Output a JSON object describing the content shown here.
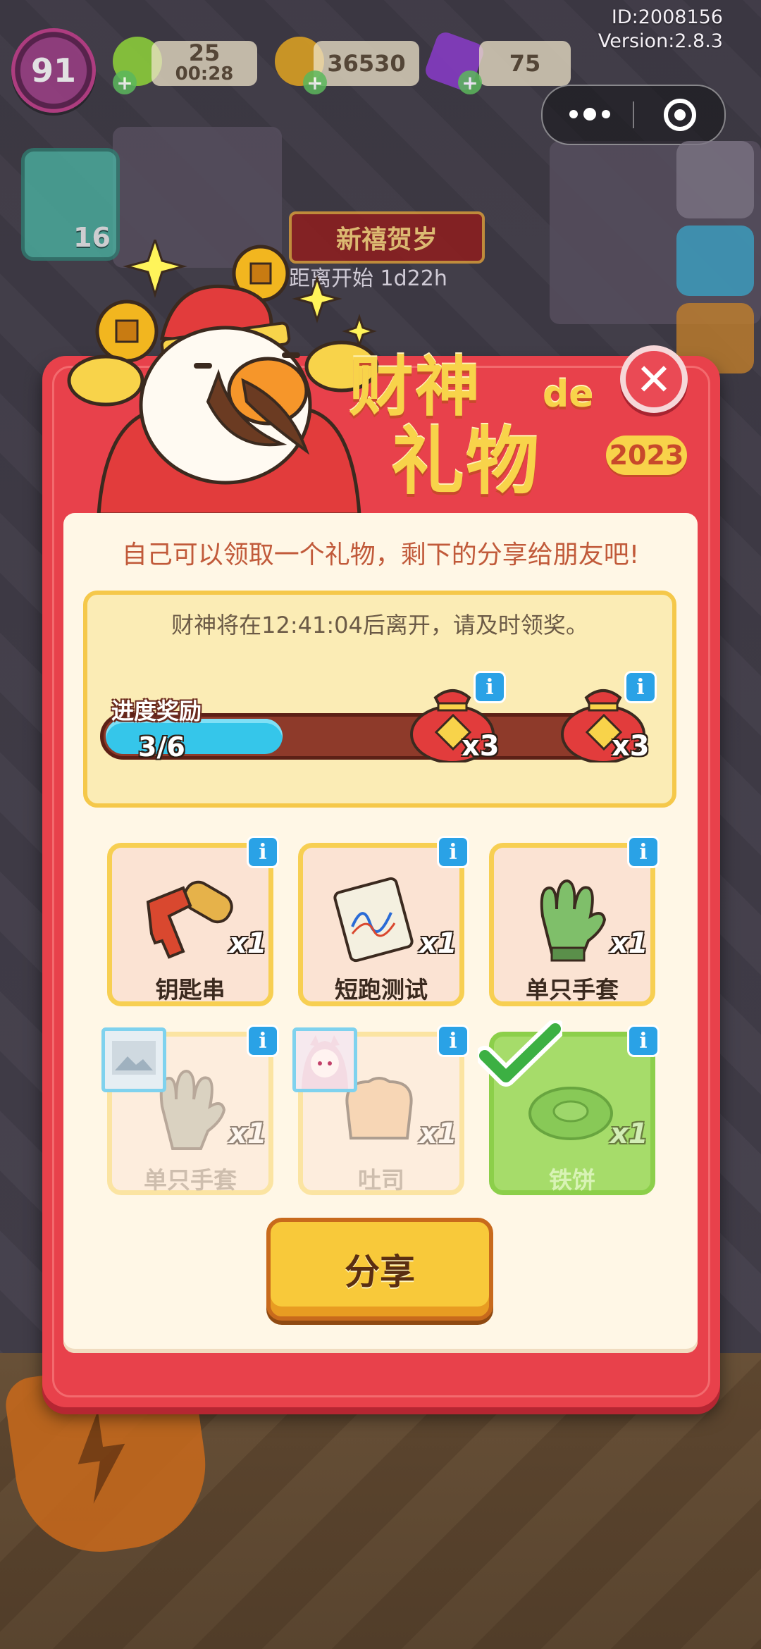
{
  "hud": {
    "id_text": "ID:2008156",
    "version_text": "Version:2.8.3",
    "level": "91",
    "energy": "25",
    "energy_timer": "00:28",
    "coins": "36530",
    "gems": "75",
    "side_badge_count": "16"
  },
  "event": {
    "banner_title": "新禧贺岁",
    "countdown": "距离开始 1d22h"
  },
  "dialog": {
    "title_line1": "财神",
    "title_de": "de",
    "title_line2": "礼物",
    "year": "2023",
    "close_symbol": "✕",
    "intro": "自己可以领取一个礼物，剩下的分享给朋友吧!",
    "leave_notice": "财神将在12:41:04后离开，请及时领奖。",
    "progress": {
      "label": "进度奖励",
      "current": 3,
      "total": 6,
      "text": "3/6",
      "rewards": [
        {
          "name": "lucky-bag",
          "count": "x3"
        },
        {
          "name": "lucky-bag",
          "count": "x3"
        }
      ]
    },
    "gifts": [
      {
        "label": "钥匙串",
        "qty": "x1",
        "state": "available"
      },
      {
        "label": "短跑测试",
        "qty": "x1",
        "state": "available"
      },
      {
        "label": "单只手套",
        "qty": "x1",
        "state": "available"
      },
      {
        "label": "单只手套",
        "qty": "x1",
        "state": "taken"
      },
      {
        "label": "吐司",
        "qty": "x1",
        "state": "taken"
      },
      {
        "label": "铁饼",
        "qty": "x1",
        "state": "claimed"
      }
    ],
    "share_label": "分享"
  },
  "colors": {
    "dialog_red": "#e8414b",
    "gold": "#f8d34a",
    "progress_fill": "#35c6ea",
    "claimed_green": "#a6dc6a"
  }
}
